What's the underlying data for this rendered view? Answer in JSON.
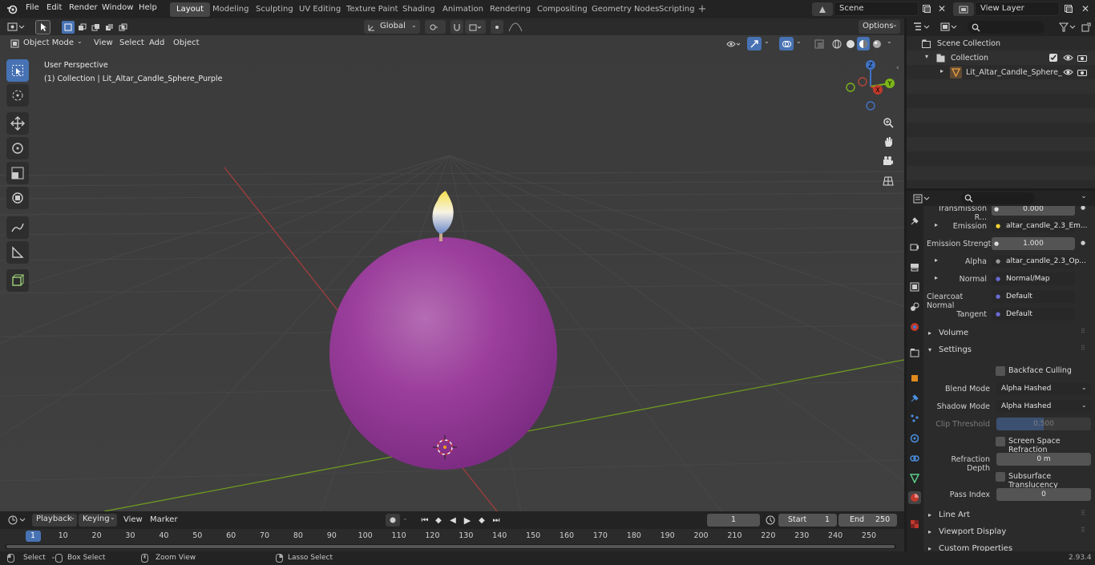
{
  "topbar": {
    "menus": [
      "File",
      "Edit",
      "Render",
      "Window",
      "Help"
    ],
    "workspaces": [
      "Layout",
      "Modeling",
      "Sculpting",
      "UV Editing",
      "Texture Paint",
      "Shading",
      "Animation",
      "Rendering",
      "Compositing",
      "Geometry Nodes",
      "Scripting"
    ],
    "active_workspace": "Layout",
    "scene": "Scene",
    "view_layer": "View Layer"
  },
  "header": {
    "transform_orientation": "Global",
    "options_label": "Options"
  },
  "viewport_header": {
    "mode": "Object Mode",
    "menus": [
      "View",
      "Select",
      "Add",
      "Object"
    ]
  },
  "viewport": {
    "perspective_label": "User Perspective",
    "collection_label": "(1) Collection | Lit_Altar_Candle_Sphere_Purple",
    "gizmo_axes": [
      "X",
      "Y",
      "Z"
    ]
  },
  "outliner": {
    "scene_collection": "Scene Collection",
    "collection": "Collection",
    "object": "Lit_Altar_Candle_Sphere_"
  },
  "properties": {
    "rows": [
      {
        "label": "Transmission R...",
        "value": "0.000"
      },
      {
        "label": "Emission",
        "value": "altar_candle_2.3_Em..."
      },
      {
        "label": "Emission Strengt",
        "value": "1.000"
      },
      {
        "label": "Alpha",
        "value": "altar_candle_2.3_Op..."
      },
      {
        "label": "Normal",
        "value": "Normal/Map"
      },
      {
        "label": "Clearcoat Normal",
        "value": "Default"
      },
      {
        "label": "Tangent",
        "value": "Default"
      }
    ],
    "panels": {
      "volume": "Volume",
      "settings": "Settings",
      "line_art": "Line Art",
      "viewport_display": "Viewport Display",
      "custom_properties": "Custom Properties"
    },
    "settings": {
      "backface_culling": "Backface Culling",
      "blend_mode_label": "Blend Mode",
      "blend_mode": "Alpha Hashed",
      "shadow_mode_label": "Shadow Mode",
      "shadow_mode": "Alpha Hashed",
      "clip_threshold_label": "Clip Threshold",
      "clip_threshold": "0.500",
      "ssr": "Screen Space Refraction",
      "refraction_depth_label": "Refraction Depth",
      "refraction_depth": "0 m",
      "subsurface": "Subsurface Translucency",
      "pass_index_label": "Pass Index",
      "pass_index": "0"
    }
  },
  "timeline": {
    "menus": [
      "Playback",
      "Keying",
      "View",
      "Marker"
    ],
    "current_frame": "1",
    "start_label": "Start",
    "start": "1",
    "end_label": "End",
    "end": "250",
    "ruler": [
      "1",
      "10",
      "20",
      "30",
      "40",
      "50",
      "60",
      "70",
      "80",
      "90",
      "100",
      "110",
      "120",
      "130",
      "140",
      "150",
      "160",
      "170",
      "180",
      "190",
      "200",
      "210",
      "220",
      "230",
      "240",
      "250"
    ]
  },
  "statusbar": {
    "select": "Select",
    "box_select": "Box Select",
    "zoom_view": "Zoom View",
    "lasso_select": "Lasso Select",
    "version": "2.93.4"
  },
  "colors": {
    "accent": "#4772b3",
    "candle": "#9b3f9c",
    "x_axis": "#c0392b",
    "y_axis": "#7cb518"
  }
}
